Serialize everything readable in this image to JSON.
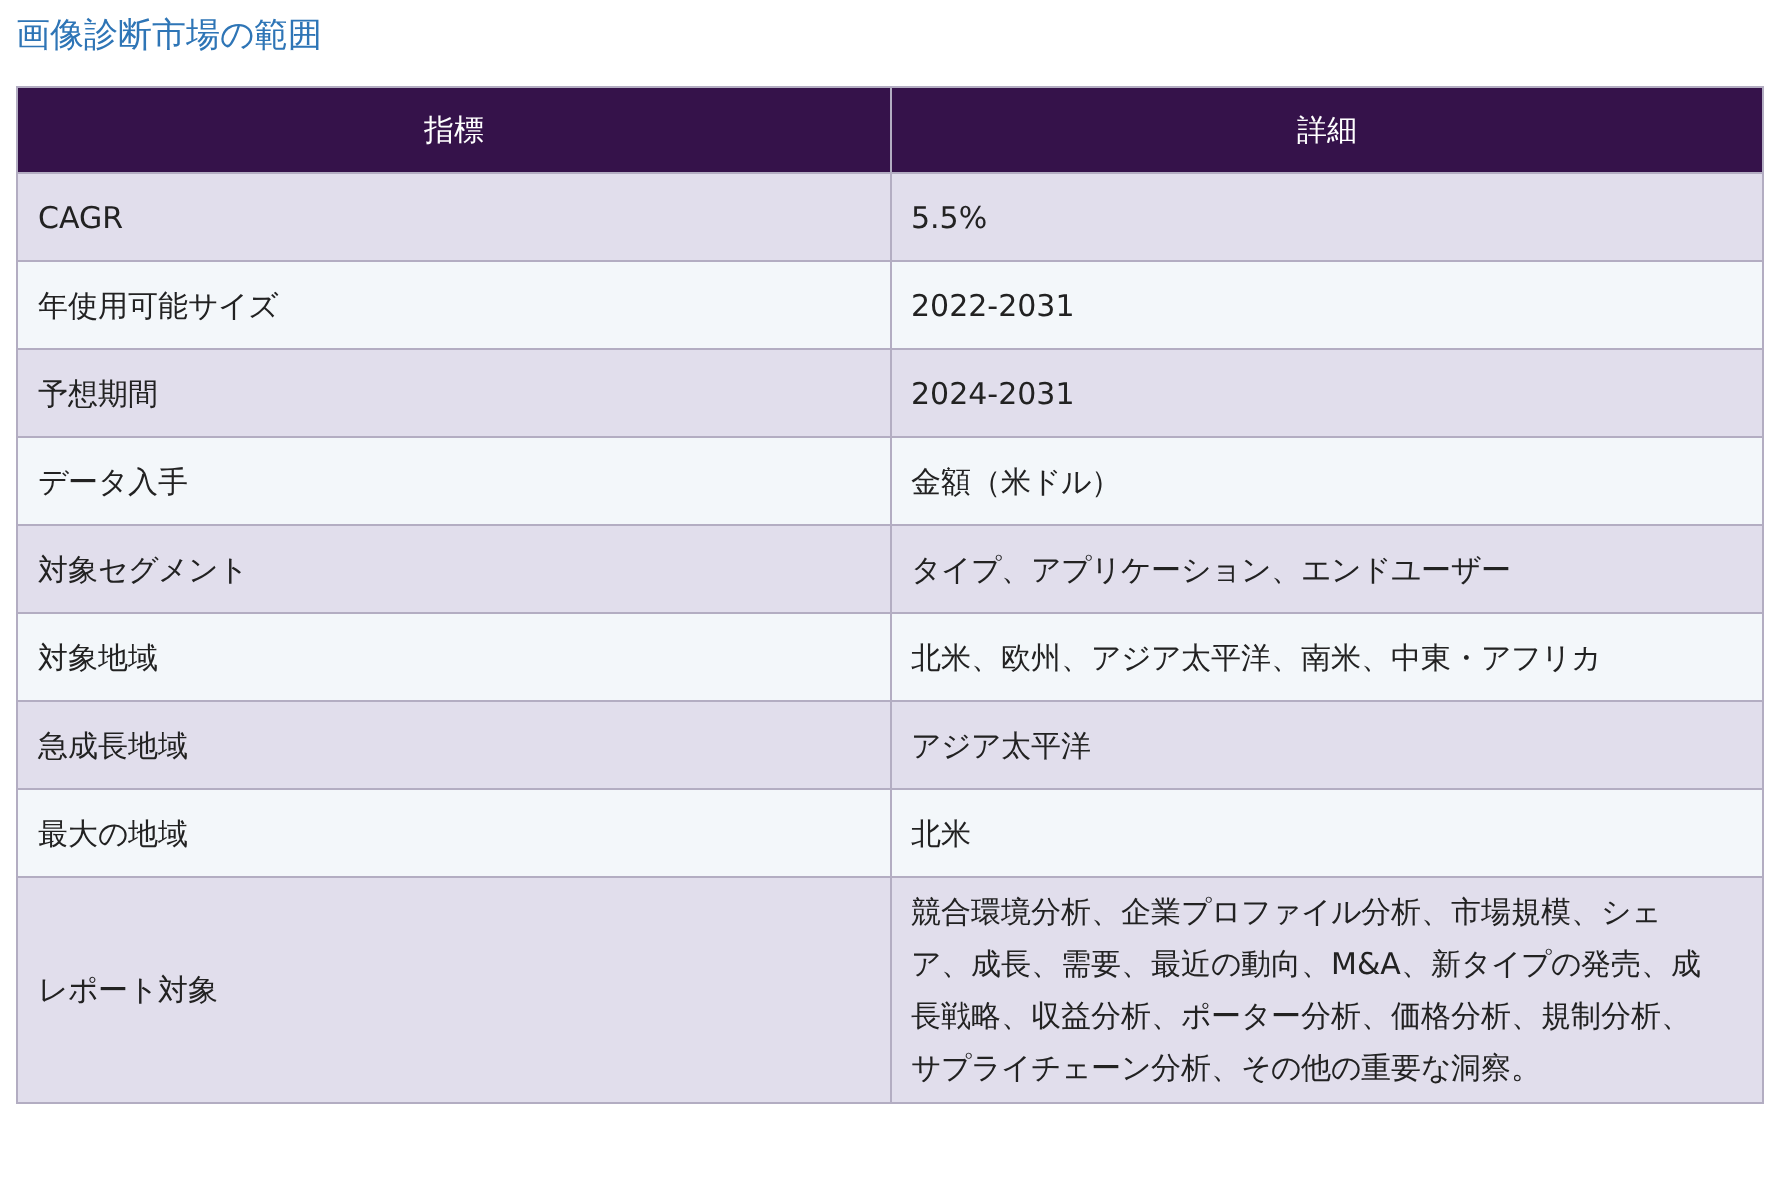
{
  "title": "画像診断市場の範囲",
  "table": {
    "columns": [
      "指標",
      "詳細"
    ],
    "rows": [
      {
        "cells": [
          "CAGR",
          "5.5%"
        ]
      },
      {
        "cells": [
          "年使用可能サイズ",
          "2022-2031"
        ]
      },
      {
        "cells": [
          "予想期間",
          "2024-2031"
        ]
      },
      {
        "cells": [
          "データ入手",
          "金額（米ドル）"
        ]
      },
      {
        "cells": [
          "対象セグメント",
          "タイプ、アプリケーション、エンドユーザー"
        ]
      },
      {
        "cells": [
          "対象地域",
          "北米、欧州、アジア太平洋、南米、中東・アフリカ"
        ]
      },
      {
        "cells": [
          "急成長地域",
          "アジア太平洋"
        ]
      },
      {
        "cells": [
          "最大の地域",
          "北米"
        ]
      },
      {
        "cells": [
          "レポート対象",
          "競合環境分析、企業プロファイル分析、市場規模、シェア、成長、需要、最近の動向、M&A、新タイプの発売、成長戦略、収益分析、ポーター分析、価格分析、規制分析、サプライチェーン分析、その他の重要な洞察。"
        ]
      }
    ]
  }
}
